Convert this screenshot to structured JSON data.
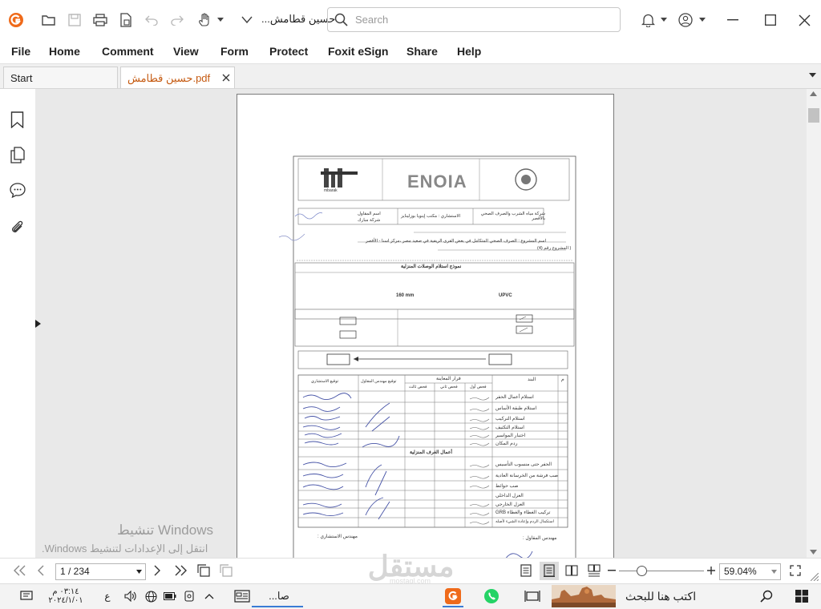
{
  "app": {
    "document_title": "حسين قطامش...",
    "search_placeholder": "Search"
  },
  "menu": [
    "File",
    "Home",
    "Comment",
    "View",
    "Form",
    "Protect",
    "Foxit eSign",
    "Share",
    "Help"
  ],
  "tabs": [
    {
      "label": "Start",
      "active": false
    },
    {
      "label": "حسين قطامش.pdf",
      "active": true
    }
  ],
  "status": {
    "page_indicator": "1 / 234",
    "zoom": "59.04%"
  },
  "watermark": {
    "line1": "تنشيط Windows",
    "line2": "انتقل إلى الإعدادات لتنشيط Windows."
  },
  "overlay_logo": {
    "text": "مستقل",
    "sub": "mostaql.com"
  },
  "taskbar": {
    "search_text": "اكتب هنا للبحث",
    "time": "٠٣:١٤ م",
    "date": "٢٠٢٤/١/٠١",
    "lang": "ع",
    "app_label": "صا..."
  },
  "document": {
    "header_brands": [
      "mbarak",
      "ENOIA"
    ],
    "company": "شركة مياه الشرب والصرف الصحي بالأقصر",
    "consultant": "الاستشاري : مكتب إينويا بوزلينايز",
    "contractor_label": "اسم المقاول",
    "contractor_name": "شركة مبارك",
    "form_title": "نموذج استلام الوصلات المنزلية",
    "project": "اسم المشروع : الصرف الصحي المتكامل في بعض القرى الريفية في صعيد مصر ،مركز اسنا - الأقصر",
    "project_no": "( المشروع رقم (4)",
    "pipe_type": "UPVC",
    "pipe_diameter": "160 mm",
    "table_headers": [
      "م",
      "البند",
      "قرار المعاينة",
      "توقيع مهندس المقاول",
      "توقيع الاستشاري"
    ],
    "inspection_sub": [
      "فحص أول",
      "فحص ثاني",
      "فحص ثالث"
    ],
    "items_a": [
      "استلام أعمال الحفر",
      "استلام طبقة الأساس",
      "استلام التركيب",
      "استلام التكثيف",
      "اختبار المواسير",
      "ردم المكان"
    ],
    "section_b": "أعمال الغرف المنزلية",
    "items_b": [
      "الحفر حتى منسوب التأسيس",
      "صب فرشة من الخرسانة العادية",
      "صب حوائط",
      "العزل الداخلي",
      "العزل الخارجي",
      "تركيب الغطاء والغطاء GRB",
      "استكمال الردم وإعادة الشيء لأصله"
    ],
    "footer_left": "مهندس المقاول :",
    "footer_right": "مهندس الاستشاري :"
  },
  "colors": {
    "accent": "#e9600f",
    "tab_active_text": "#c55a11"
  }
}
